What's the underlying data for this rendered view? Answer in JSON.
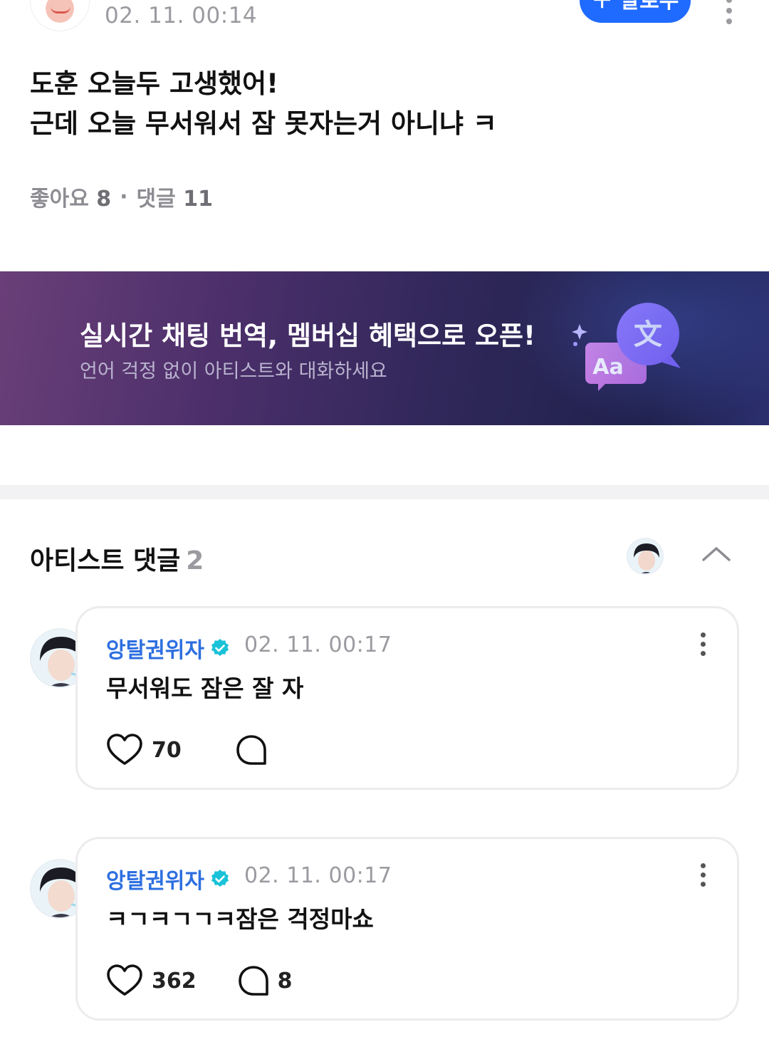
{
  "post": {
    "time": "02. 11. 00:14",
    "follow_label": "팔로우",
    "body_line1": "도훈 오늘두 고생했어!",
    "body_line2": "근데 오늘 무서워서 잠 못자는거 아니냐 ㅋ",
    "likes_label": "좋아요",
    "likes_count": "8",
    "separator": "·",
    "comments_label": "댓글",
    "comments_count": "11"
  },
  "banner": {
    "title": "실시간 채팅 번역, 멤버십 혜택으로 오픈!",
    "subtitle": "언어 걱정 없이 아티스트와 대화하세요",
    "icon_glyph_top": "文",
    "icon_glyph_bottom": "Aa",
    "colors": {
      "bubble_top": "#8a6cf0",
      "bubble_bottom": "#c47ad8"
    }
  },
  "artist_comments": {
    "title": "아티스트 댓글",
    "count": "2"
  },
  "comments": [
    {
      "author": "앙탈권위자",
      "time": "02. 11. 00:17",
      "text": "무서워도 잠은 잘 자",
      "likes": "70",
      "replies": ""
    },
    {
      "author": "앙탈권위자",
      "time": "02. 11. 00:17",
      "text": "ㅋㄱㅋㄱㄱㅋ잠은 걱정마쇼",
      "likes": "362",
      "replies": "8"
    }
  ],
  "colors": {
    "accent": "#1f6bff",
    "artist_name": "#2d6fe0",
    "verified": "#19c2d8",
    "muted": "#9a9aa0"
  }
}
